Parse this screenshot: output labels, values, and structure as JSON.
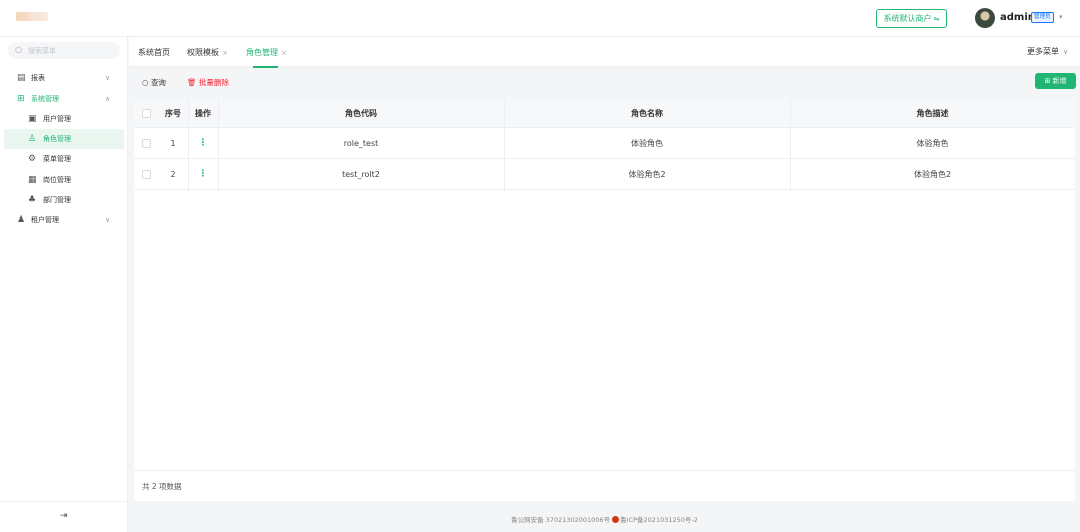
{
  "header": {
    "tenant_button": "系统默认商户",
    "tenant_switch_icon": "switch-icon",
    "user_name": "admin",
    "role_tag": "管理员",
    "user_caret": "⌄"
  },
  "sidebar": {
    "search_placeholder": "搜索菜单",
    "items": [
      {
        "label": "报表",
        "icon": "report-icon"
      },
      {
        "label": "系统管理",
        "icon": "apps-icon"
      },
      {
        "label": "用户管理",
        "icon": "user-icon"
      },
      {
        "label": "角色管理",
        "icon": "role-icon"
      },
      {
        "label": "菜单管理",
        "icon": "menu-icon"
      },
      {
        "label": "岗位管理",
        "icon": "post-icon"
      },
      {
        "label": "部门管理",
        "icon": "dept-icon"
      },
      {
        "label": "租户管理",
        "icon": "tenant-icon"
      }
    ],
    "collapse_icon": "⇥"
  },
  "tabs": [
    {
      "label": "系统首页"
    },
    {
      "label": "权限模板",
      "close": "×"
    },
    {
      "label": "角色管理",
      "close": "×"
    }
  ],
  "more_menu": "更多菜单",
  "toolbar": {
    "query": "查询",
    "batch_delete": "批量删除",
    "new": "新增"
  },
  "table": {
    "columns": [
      "序号",
      "操作",
      "角色代码",
      "角色名称",
      "角色描述"
    ],
    "rows": [
      {
        "index": "1",
        "code": "role_test",
        "name": "体验角色",
        "desc": "体验角色"
      },
      {
        "index": "2",
        "code": "test_rolt2",
        "name": "体验角色2",
        "desc": "体验角色2"
      }
    ],
    "action_icon": "⋮",
    "total": "共 2 项数据"
  },
  "footer": {
    "police": "鲁公网安备 37021302001006号",
    "icp": "鲁ICP备2021031250号-2"
  },
  "colors": {
    "accent": "#21b573",
    "danger": "#f5222d"
  }
}
